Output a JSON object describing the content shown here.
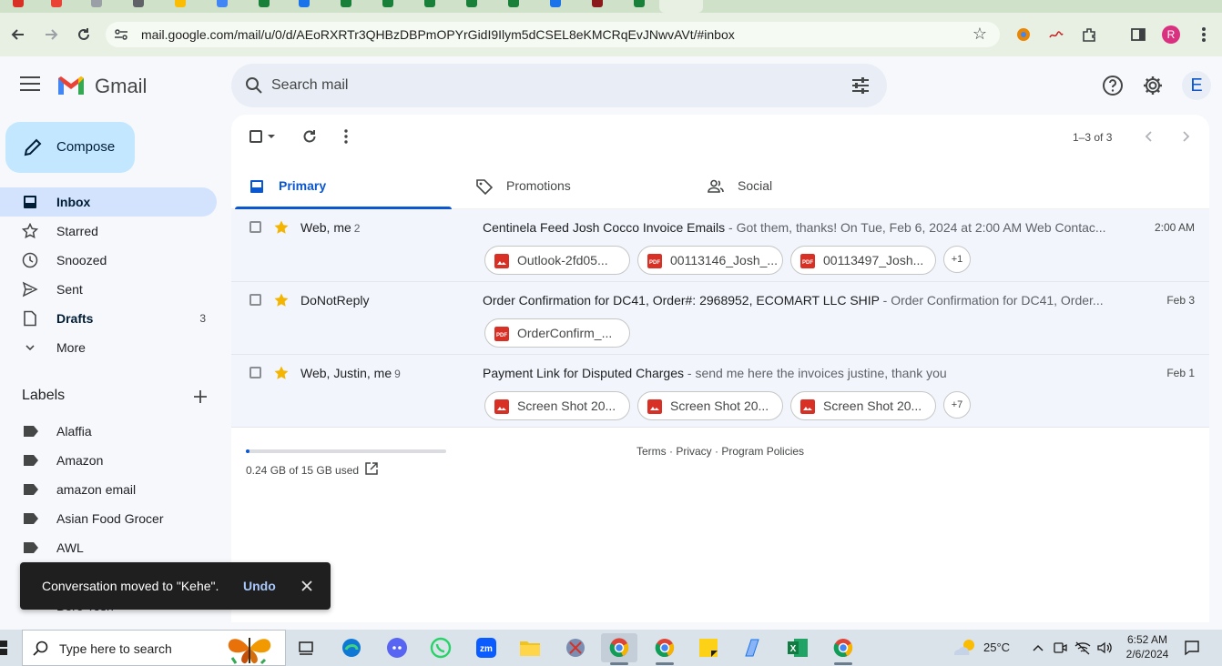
{
  "browser": {
    "url": "mail.google.com/mail/u/0/d/AEoRXRTr3QHBzDBPmOPYrGidI9Ilym5dCSEL8eKMCRqEvJNwvAVt/#inbox",
    "profile_initial": "R"
  },
  "header": {
    "app_name": "Gmail",
    "search_placeholder": "Search mail",
    "account_initial": "E"
  },
  "sidebar": {
    "compose_label": "Compose",
    "nav": [
      {
        "label": "Inbox",
        "count": ""
      },
      {
        "label": "Starred",
        "count": ""
      },
      {
        "label": "Snoozed",
        "count": ""
      },
      {
        "label": "Sent",
        "count": ""
      },
      {
        "label": "Drafts",
        "count": "3"
      },
      {
        "label": "More",
        "count": ""
      }
    ],
    "labels_heading": "Labels",
    "labels": [
      "Alaffia",
      "Amazon",
      "amazon email",
      "Asian Food Grocer",
      "AWL"
    ],
    "partially_hidden_label": "Bere Tosh"
  },
  "main": {
    "pager": "1–3 of 3",
    "tabs": [
      {
        "label": "Primary"
      },
      {
        "label": "Promotions"
      },
      {
        "label": "Social"
      }
    ],
    "emails": [
      {
        "sender": "Web, me",
        "count": "2",
        "subject": "Centinela Feed Josh Cocco Invoice Emails",
        "snippet": " - Got them, thanks! On Tue, Feb 6, 2024 at 2:00 AM Web Contac...",
        "date": "2:00 AM",
        "attachments": [
          {
            "name": "Outlook-2fd05...",
            "type": "image"
          },
          {
            "name": "00113146_Josh_...",
            "type": "pdf"
          },
          {
            "name": "00113497_Josh...",
            "type": "pdf"
          }
        ],
        "more": "+1"
      },
      {
        "sender": "DoNotReply",
        "count": "",
        "subject": "Order Confirmation for DC41, Order#: 2968952, ECOMART LLC SHIP",
        "snippet": " - Order Confirmation for DC41, Order...",
        "date": "Feb 3",
        "attachments": [
          {
            "name": "OrderConfirm_...",
            "type": "pdf"
          }
        ],
        "more": ""
      },
      {
        "sender": "Web, Justin, me",
        "count": "9",
        "subject": "Payment Link for Disputed Charges",
        "snippet": " - send me here the invoices justine, thank you",
        "date": "Feb 1",
        "attachments": [
          {
            "name": "Screen Shot 20...",
            "type": "image"
          },
          {
            "name": "Screen Shot 20...",
            "type": "image"
          },
          {
            "name": "Screen Shot 20...",
            "type": "image"
          }
        ],
        "more": "+7"
      }
    ],
    "storage": {
      "text": "0.24 GB of 15 GB used",
      "fraction": 0.016
    },
    "footer": {
      "terms": "Terms",
      "privacy": "Privacy",
      "policies": "Program Policies",
      "sep": " · "
    }
  },
  "snackbar": {
    "message": "Conversation moved to \"Kehe\".",
    "action": "Undo"
  },
  "taskbar": {
    "search_text": "Type here to search",
    "weather": "25°C",
    "time": "6:52 AM",
    "date": "2/6/2024"
  },
  "colors": {
    "accent": "#0b57d0",
    "compose_bg": "#c2e7ff",
    "active_nav": "#d3e3fd",
    "star": "#f4b400",
    "pdf_red": "#d93025"
  }
}
